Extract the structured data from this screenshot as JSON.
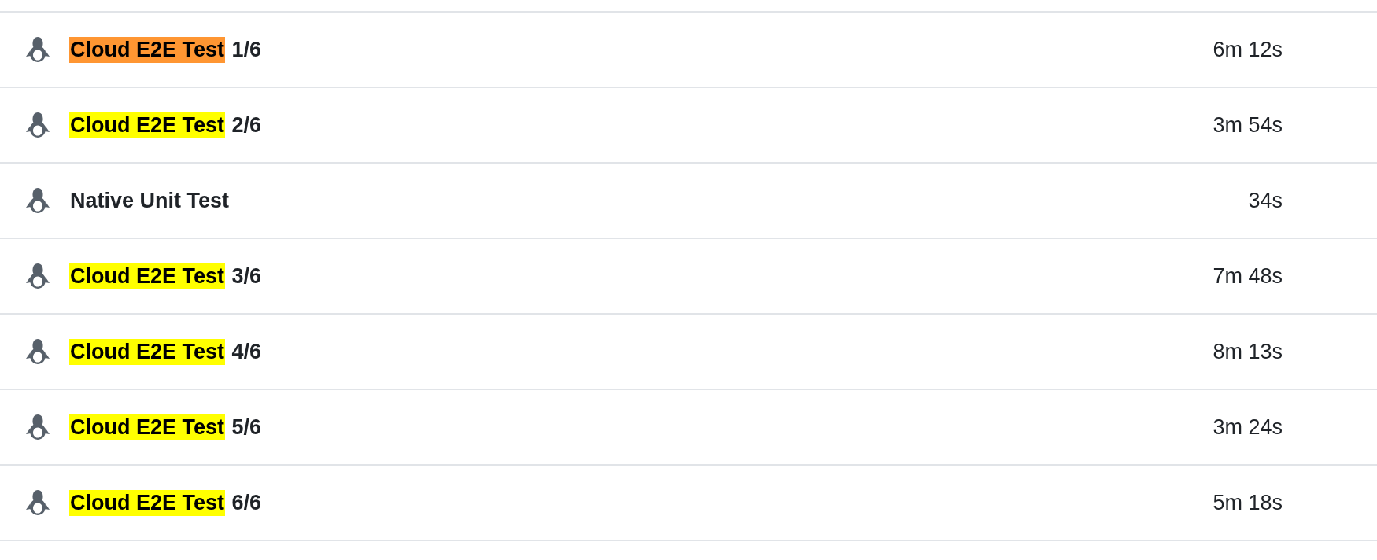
{
  "jobs": [
    {
      "name_parts": [
        {
          "text": "Cloud E2E Test",
          "highlighted": true,
          "current": true
        },
        {
          "text": "1/6",
          "highlighted": false,
          "current": false
        }
      ],
      "duration": "6m 12s"
    },
    {
      "name_parts": [
        {
          "text": "Cloud E2E Test",
          "highlighted": true,
          "current": false
        },
        {
          "text": "2/6",
          "highlighted": false,
          "current": false
        }
      ],
      "duration": "3m 54s"
    },
    {
      "name_parts": [
        {
          "text": "Native Unit Test",
          "highlighted": false,
          "current": false
        }
      ],
      "duration": "34s"
    },
    {
      "name_parts": [
        {
          "text": "Cloud E2E Test",
          "highlighted": true,
          "current": false
        },
        {
          "text": "3/6",
          "highlighted": false,
          "current": false
        }
      ],
      "duration": "7m 48s"
    },
    {
      "name_parts": [
        {
          "text": "Cloud E2E Test",
          "highlighted": true,
          "current": false
        },
        {
          "text": "4/6",
          "highlighted": false,
          "current": false
        }
      ],
      "duration": "8m 13s"
    },
    {
      "name_parts": [
        {
          "text": "Cloud E2E Test",
          "highlighted": true,
          "current": false
        },
        {
          "text": "5/6",
          "highlighted": false,
          "current": false
        }
      ],
      "duration": "3m 24s"
    },
    {
      "name_parts": [
        {
          "text": "Cloud E2E Test",
          "highlighted": true,
          "current": false
        },
        {
          "text": "6/6",
          "highlighted": false,
          "current": false
        }
      ],
      "duration": "5m 18s"
    }
  ]
}
